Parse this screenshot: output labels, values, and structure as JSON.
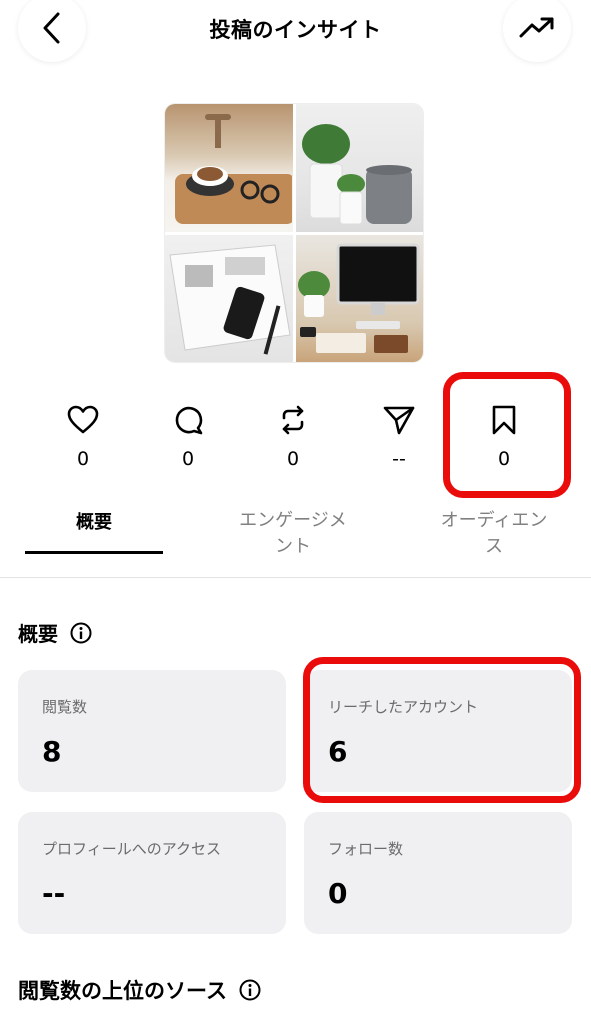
{
  "header": {
    "title": "投稿のインサイト"
  },
  "stats": [
    {
      "icon": "heart-icon",
      "value": "0"
    },
    {
      "icon": "comment-icon",
      "value": "0"
    },
    {
      "icon": "repost-icon",
      "value": "0"
    },
    {
      "icon": "send-icon",
      "value": "--"
    },
    {
      "icon": "bookmark-icon",
      "value": "0"
    }
  ],
  "tabs": [
    {
      "label": "概要"
    },
    {
      "label_line1": "エンゲージメ",
      "label_line2": "ント"
    },
    {
      "label_line1": "オーディエン",
      "label_line2": "ス"
    }
  ],
  "overview": {
    "title": "概要",
    "cards": [
      {
        "label": "閲覧数",
        "value": "8"
      },
      {
        "label": "リーチしたアカウント",
        "value": "6"
      },
      {
        "label": "プロフィールへのアクセス",
        "value": "--"
      },
      {
        "label": "フォロー数",
        "value": "0"
      }
    ]
  },
  "top_sources": {
    "title": "閲覧数の上位のソース"
  },
  "colors": {
    "highlight": "#ea0b0b",
    "card_bg": "#f0f0f3",
    "tab_inactive": "#808080"
  }
}
